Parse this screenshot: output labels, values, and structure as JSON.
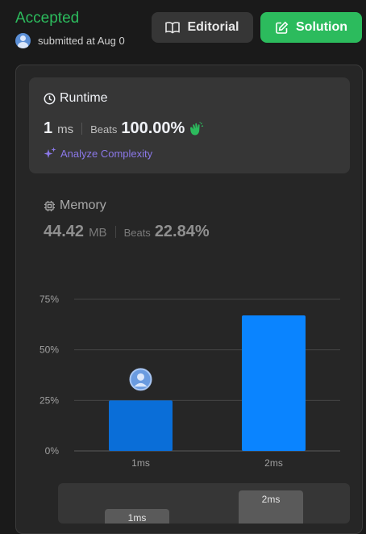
{
  "header": {
    "status": "Accepted",
    "submitted_text": "submitted at Aug 0",
    "editorial_label": "Editorial",
    "solution_label": "Solution"
  },
  "runtime": {
    "title": "Runtime",
    "value": "1",
    "unit": "ms",
    "beats_label": "Beats",
    "beats_pct": "100.00%",
    "analyze_label": "Analyze Complexity"
  },
  "memory": {
    "title": "Memory",
    "value": "44.42",
    "unit": "MB",
    "beats_label": "Beats",
    "beats_pct": "22.84%"
  },
  "colors": {
    "accepted": "#2cbb5d",
    "bar_user": "#0a6ed8",
    "bar_other": "#0a84ff",
    "analyze": "#8b78e8"
  },
  "chart_data": {
    "type": "bar",
    "categories": [
      "1ms",
      "2ms"
    ],
    "values": [
      25,
      67
    ],
    "ylim": [
      0,
      75
    ],
    "yticks": [
      "0%",
      "25%",
      "50%",
      "75%"
    ],
    "grid": true,
    "highlight_index": 0
  },
  "navigator": {
    "labels": [
      "1ms",
      "2ms"
    ]
  }
}
